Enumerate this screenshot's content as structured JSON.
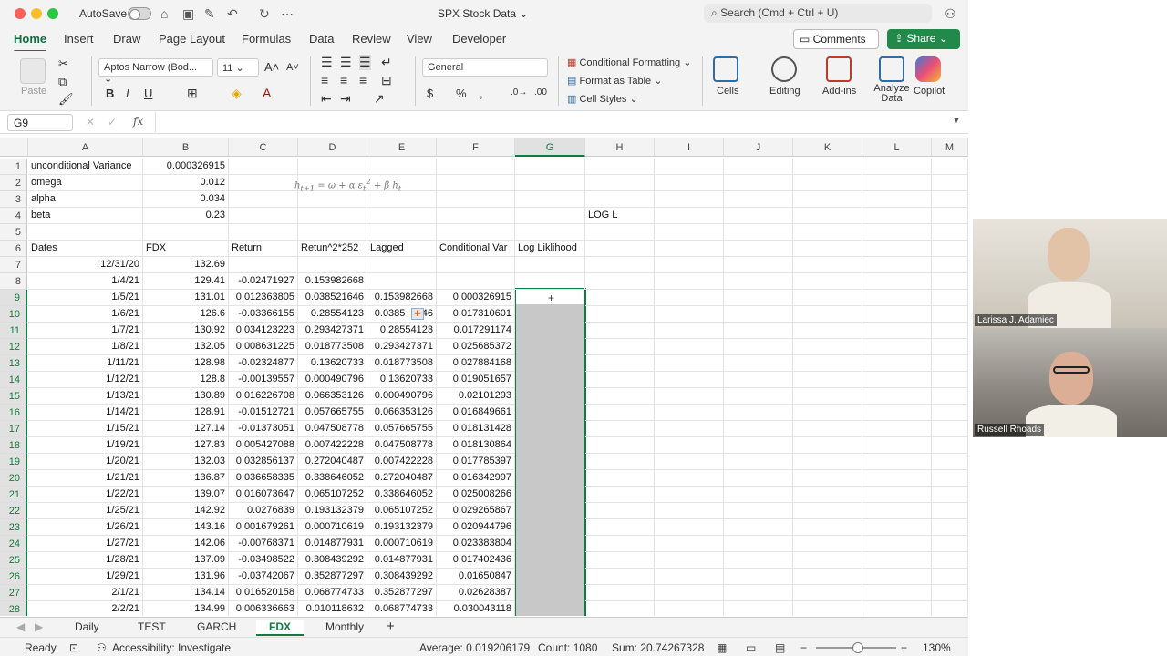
{
  "window": {
    "autosave_label": "AutoSave",
    "doc_title": "SPX Stock Data",
    "search_placeholder": "Search (Cmd + Ctrl + U)"
  },
  "ribbon_tabs": [
    "Home",
    "Insert",
    "Draw",
    "Page Layout",
    "Formulas",
    "Data",
    "Review",
    "View",
    "Developer"
  ],
  "buttons": {
    "comments": "Comments",
    "share": "Share"
  },
  "ribbon": {
    "paste": "Paste",
    "font_name": "Aptos Narrow (Bod...",
    "font_size": "11",
    "number_format": "General",
    "conditional_formatting": "Conditional Formatting",
    "format_as_table": "Format as Table",
    "cell_styles": "Cell Styles",
    "cells": "Cells",
    "editing": "Editing",
    "addins": "Add-ins",
    "analyze_data": "Analyze Data",
    "copilot": "Copilot"
  },
  "formula_bar": {
    "name_box": "G9",
    "fx": "fx",
    "content": ""
  },
  "columns": [
    "A",
    "B",
    "C",
    "D",
    "E",
    "F",
    "G",
    "H",
    "I",
    "J",
    "K",
    "L",
    "M"
  ],
  "formula_image_text": "h_{t+1} = ω + α ε_t² + β h_t",
  "rows": [
    {
      "n": "1",
      "A": "unconditional Variance",
      "B": "0.000326915"
    },
    {
      "n": "2",
      "A": "omega",
      "B": "0.012"
    },
    {
      "n": "3",
      "A": "alpha",
      "B": "0.034"
    },
    {
      "n": "4",
      "A": "beta",
      "B": "0.23",
      "H": "LOG L"
    },
    {
      "n": "5"
    },
    {
      "n": "6",
      "A": "Dates",
      "B": "FDX",
      "C": "Return",
      "D": "Retun^2*252",
      "E": "Lagged",
      "F": "Conditional Var",
      "G": "Log Liklihood"
    },
    {
      "n": "7",
      "A": "12/31/20",
      "B": "132.69"
    },
    {
      "n": "8",
      "A": "1/4/21",
      "B": "129.41",
      "C": "-0.02471927",
      "D": "0.153982668"
    },
    {
      "n": "9",
      "A": "1/5/21",
      "B": "131.01",
      "C": "0.012363805",
      "D": "0.038521646",
      "E": "0.153982668",
      "F": "0.000326915"
    },
    {
      "n": "10",
      "A": "1/6/21",
      "B": "126.6",
      "C": "-0.03366155",
      "D": "0.28554123",
      "E": "0.0385    646",
      "F": "0.017310601"
    },
    {
      "n": "11",
      "A": "1/7/21",
      "B": "130.92",
      "C": "0.034123223",
      "D": "0.293427371",
      "E": "0.28554123",
      "F": "0.017291174"
    },
    {
      "n": "12",
      "A": "1/8/21",
      "B": "132.05",
      "C": "0.008631225",
      "D": "0.018773508",
      "E": "0.293427371",
      "F": "0.025685372"
    },
    {
      "n": "13",
      "A": "1/11/21",
      "B": "128.98",
      "C": "-0.02324877",
      "D": "0.13620733",
      "E": "0.018773508",
      "F": "0.027884168"
    },
    {
      "n": "14",
      "A": "1/12/21",
      "B": "128.8",
      "C": "-0.00139557",
      "D": "0.000490796",
      "E": "0.13620733",
      "F": "0.019051657"
    },
    {
      "n": "15",
      "A": "1/13/21",
      "B": "130.89",
      "C": "0.016226708",
      "D": "0.066353126",
      "E": "0.000490796",
      "F": "0.02101293"
    },
    {
      "n": "16",
      "A": "1/14/21",
      "B": "128.91",
      "C": "-0.01512721",
      "D": "0.057665755",
      "E": "0.066353126",
      "F": "0.016849661"
    },
    {
      "n": "17",
      "A": "1/15/21",
      "B": "127.14",
      "C": "-0.01373051",
      "D": "0.047508778",
      "E": "0.057665755",
      "F": "0.018131428"
    },
    {
      "n": "18",
      "A": "1/19/21",
      "B": "127.83",
      "C": "0.005427088",
      "D": "0.007422228",
      "E": "0.047508778",
      "F": "0.018130864"
    },
    {
      "n": "19",
      "A": "1/20/21",
      "B": "132.03",
      "C": "0.032856137",
      "D": "0.272040487",
      "E": "0.007422228",
      "F": "0.017785397"
    },
    {
      "n": "20",
      "A": "1/21/21",
      "B": "136.87",
      "C": "0.036658335",
      "D": "0.338646052",
      "E": "0.272040487",
      "F": "0.016342997"
    },
    {
      "n": "21",
      "A": "1/22/21",
      "B": "139.07",
      "C": "0.016073647",
      "D": "0.065107252",
      "E": "0.338646052",
      "F": "0.025008266"
    },
    {
      "n": "22",
      "A": "1/25/21",
      "B": "142.92",
      "C": "0.0276839",
      "D": "0.193132379",
      "E": "0.065107252",
      "F": "0.029265867"
    },
    {
      "n": "23",
      "A": "1/26/21",
      "B": "143.16",
      "C": "0.001679261",
      "D": "0.000710619",
      "E": "0.193132379",
      "F": "0.020944796"
    },
    {
      "n": "24",
      "A": "1/27/21",
      "B": "142.06",
      "C": "-0.00768371",
      "D": "0.014877931",
      "E": "0.000710619",
      "F": "0.023383804"
    },
    {
      "n": "25",
      "A": "1/28/21",
      "B": "137.09",
      "C": "-0.03498522",
      "D": "0.308439292",
      "E": "0.014877931",
      "F": "0.017402436"
    },
    {
      "n": "26",
      "A": "1/29/21",
      "B": "131.96",
      "C": "-0.03742067",
      "D": "0.352877297",
      "E": "0.308439292",
      "F": "0.01650847"
    },
    {
      "n": "27",
      "A": "2/1/21",
      "B": "134.14",
      "C": "0.016520158",
      "D": "0.068774733",
      "E": "0.352877297",
      "F": "0.02628387"
    },
    {
      "n": "28",
      "A": "2/2/21",
      "B": "134.99",
      "C": "0.006336663",
      "D": "0.010118632",
      "E": "0.068774733",
      "F": "0.030043118"
    }
  ],
  "video": [
    {
      "name": "Larissa J. Adamiec"
    },
    {
      "name": "Russell Rhoads"
    }
  ],
  "sheet_tabs": [
    "Daily",
    "TEST",
    "GARCH",
    "FDX",
    "Monthly"
  ],
  "active_sheet": "FDX",
  "status": {
    "ready": "Ready",
    "accessibility": "Accessibility: Investigate",
    "average": "Average: 0.019206179",
    "count": "Count: 1080",
    "sum": "Sum: 20.74267328",
    "zoom": "130%"
  }
}
